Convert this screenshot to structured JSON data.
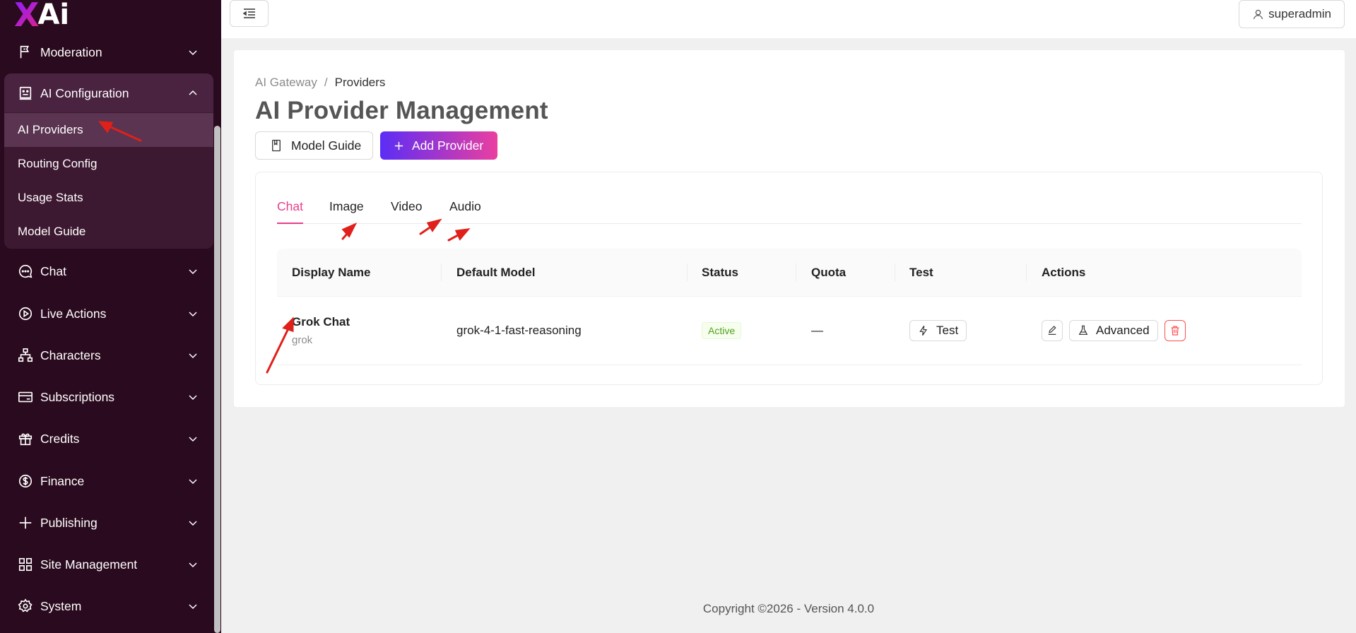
{
  "app": {
    "logo_x": "X",
    "logo_ai": "Ai",
    "colors": {
      "sidebar_bg": "#2a0a1e",
      "accent_pink": "#e83e8c",
      "accent_purple": "#5b2df5",
      "success": "#52a020",
      "danger": "#ff4d4f"
    }
  },
  "sidebar": {
    "items": [
      {
        "label": "Moderation",
        "icon": "flag-icon"
      },
      {
        "label": "AI Configuration",
        "icon": "robot-icon",
        "expanded": true
      },
      {
        "label": "Chat",
        "icon": "chat-bubble-icon"
      },
      {
        "label": "Live Actions",
        "icon": "play-circle-icon"
      },
      {
        "label": "Characters",
        "icon": "hierarchy-icon"
      },
      {
        "label": "Subscriptions",
        "icon": "credit-card-icon"
      },
      {
        "label": "Credits",
        "icon": "gift-icon"
      },
      {
        "label": "Finance",
        "icon": "dollar-circle-icon"
      },
      {
        "label": "Publishing",
        "icon": "plus-icon"
      },
      {
        "label": "Site Management",
        "icon": "grid-icon"
      },
      {
        "label": "System",
        "icon": "gear-icon"
      }
    ],
    "ai_config_sub": [
      {
        "label": "AI Providers",
        "active": true
      },
      {
        "label": "Routing Config"
      },
      {
        "label": "Usage Stats"
      },
      {
        "label": "Model Guide"
      }
    ]
  },
  "header": {
    "user": "superadmin"
  },
  "main": {
    "breadcrumb": {
      "parent": "AI Gateway",
      "sep": "/",
      "current": "Providers"
    },
    "title": "AI Provider Management",
    "buttons": {
      "model_guide": "Model Guide",
      "add_provider": "Add Provider"
    },
    "tabs": [
      {
        "label": "Chat",
        "active": true
      },
      {
        "label": "Image"
      },
      {
        "label": "Video"
      },
      {
        "label": "Audio"
      }
    ],
    "table": {
      "columns": [
        "Display Name",
        "Default Model",
        "Status",
        "Quota",
        "Test",
        "Actions"
      ],
      "rows": [
        {
          "name": "Grok Chat",
          "provider": "grok",
          "model": "grok-4-1-fast-reasoning",
          "status": "Active",
          "quota": "—",
          "test_label": "Test",
          "advanced_label": "Advanced"
        }
      ]
    }
  },
  "footer": {
    "text": "Copyright ©2026 - Version 4.0.0"
  }
}
